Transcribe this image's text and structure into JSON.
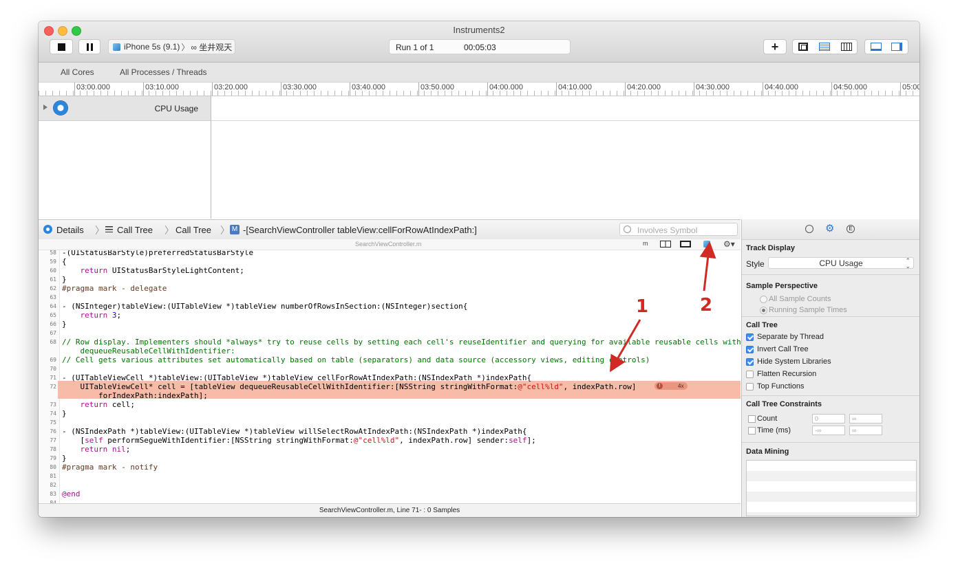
{
  "window": {
    "title": "Instruments2",
    "traffic_lights": {
      "close": "#fc605c",
      "minimize": "#fdbc40",
      "zoom": "#34c84a"
    }
  },
  "toolbar": {
    "stop_icon": "stop-icon",
    "pause_icon": "pause-icon",
    "device_label": "iPhone 5s (9.1)",
    "device_separator": "〉",
    "process_label": "∞ 坐井观天",
    "run_label": "Run 1 of 1",
    "run_time": "00:05:03",
    "add_icon": "plus-icon"
  },
  "scope_bar": {
    "cores": "All Cores",
    "processes": "All Processes / Threads"
  },
  "ruler": {
    "ticks": [
      "03:00.000",
      "03:10.000",
      "03:20.000",
      "03:30.000",
      "03:40.000",
      "03:50.000",
      "04:00.000",
      "04:10.000",
      "04:20.000",
      "04:30.000",
      "04:40.000",
      "04:50.000",
      "05:00"
    ]
  },
  "track": {
    "name": "CPU Usage"
  },
  "jump_bar": {
    "details": "Details",
    "crumb1": "Call Tree",
    "crumb2": "Call Tree",
    "method_badge": "M",
    "method": "-[SearchViewController tableView:cellForRowAtIndexPath:]",
    "search_placeholder": "Involves Symbol"
  },
  "editor": {
    "filename": "SearchViewController.m",
    "header_m": "m",
    "highlight_count": "4x",
    "status": "SearchViewController.m, Line 71- : 0 Samples"
  },
  "code_lines": [
    {
      "n": "58",
      "t": "-(UIStatusBarStyle)preferredStatusBarStyle"
    },
    {
      "n": "59",
      "t": "{"
    },
    {
      "n": "60",
      "t": "    return UIStatusBarStyleLightContent;"
    },
    {
      "n": "61",
      "t": "}"
    },
    {
      "n": "62",
      "t": "#pragma mark - delegate"
    },
    {
      "n": "63",
      "t": ""
    },
    {
      "n": "64",
      "t": "- (NSInteger)tableView:(UITableView *)tableView numberOfRowsInSection:(NSInteger)section{"
    },
    {
      "n": "65",
      "t": "    return 3;"
    },
    {
      "n": "66",
      "t": "}"
    },
    {
      "n": "67",
      "t": ""
    },
    {
      "n": "68",
      "t": "// Row display. Implementers should *always* try to reuse cells by setting each cell's reuseIdentifier and querying for available reusable cells with"
    },
    {
      "n": "",
      "t": "    dequeueReusableCellWithIdentifier:"
    },
    {
      "n": "69",
      "t": "// Cell gets various attributes set automatically based on table (separators) and data source (accessory views, editing controls)"
    },
    {
      "n": "70",
      "t": ""
    },
    {
      "n": "71",
      "t": "- (UITableViewCell *)tableView:(UITableView *)tableView cellForRowAtIndexPath:(NSIndexPath *)indexPath{"
    },
    {
      "n": "72",
      "t": "    UITableViewCell* cell = [tableView dequeueReusableCellWithIdentifier:[NSString stringWithFormat:@\"cell%ld\", indexPath.row]"
    },
    {
      "n": "",
      "t": "        forIndexPath:indexPath];"
    },
    {
      "n": "73",
      "t": "    return cell;"
    },
    {
      "n": "74",
      "t": "}"
    },
    {
      "n": "75",
      "t": ""
    },
    {
      "n": "76",
      "t": "- (NSIndexPath *)tableView:(UITableView *)tableView willSelectRowAtIndexPath:(NSIndexPath *)indexPath{"
    },
    {
      "n": "77",
      "t": "    [self performSegueWithIdentifier:[NSString stringWithFormat:@\"cell%ld\", indexPath.row] sender:self];"
    },
    {
      "n": "78",
      "t": "    return nil;"
    },
    {
      "n": "79",
      "t": "}"
    },
    {
      "n": "80",
      "t": "#pragma mark - notify"
    },
    {
      "n": "81",
      "t": ""
    },
    {
      "n": "82",
      "t": ""
    },
    {
      "n": "83",
      "t": "@end"
    },
    {
      "n": "84",
      "t": ""
    }
  ],
  "inspector": {
    "track_display": "Track Display",
    "style_label": "Style",
    "style_value": "CPU Usage",
    "sample_perspective": "Sample Perspective",
    "all_sample_counts": "All Sample Counts",
    "running_sample_times": "Running Sample Times",
    "call_tree": "Call Tree",
    "options": [
      {
        "label": "Separate by Thread",
        "checked": true
      },
      {
        "label": "Invert Call Tree",
        "checked": true
      },
      {
        "label": "Hide System Libraries",
        "checked": true
      },
      {
        "label": "Flatten Recursion",
        "checked": false
      },
      {
        "label": "Top Functions",
        "checked": false
      }
    ],
    "constraints": "Call Tree Constraints",
    "count": "Count",
    "time": "Time (ms)",
    "count_min": "0",
    "count_max": "∞",
    "time_min": "-∞",
    "time_max": "∞",
    "data_mining": "Data Mining"
  },
  "annotations": {
    "one": "1",
    "two": "2"
  }
}
